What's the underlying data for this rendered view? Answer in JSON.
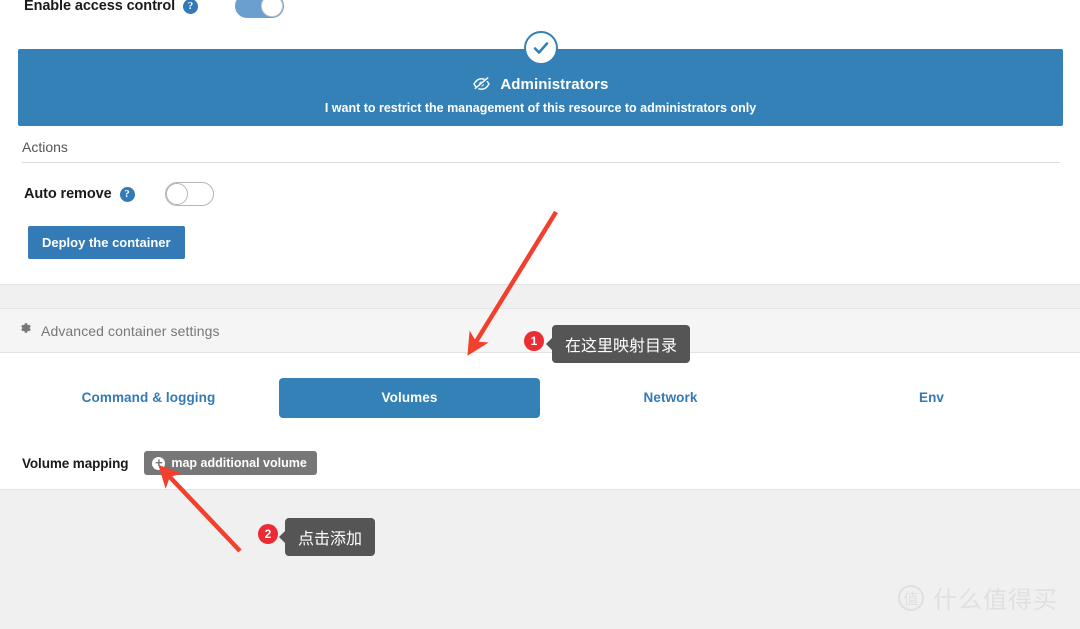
{
  "access_control": {
    "label": "Enable access control",
    "help_icon": "question-circle-icon",
    "toggle_state": "on"
  },
  "admin_card": {
    "check_icon": "check-circle-icon",
    "title_icon": "eye-slash-icon",
    "title": "Administrators",
    "subtitle": "I want to restrict the management of this resource to administrators only",
    "background_color": "#3481b8"
  },
  "actions": {
    "section_title": "Actions",
    "auto_remove_label": "Auto remove",
    "auto_remove_help_icon": "question-circle-icon",
    "auto_remove_toggle_state": "off",
    "deploy_button": "Deploy the container",
    "deploy_button_color": "#337ab7"
  },
  "advanced": {
    "header_icon": "gear-icon",
    "header_label": "Advanced container settings",
    "tabs": [
      {
        "label": "Command & logging",
        "active": false
      },
      {
        "label": "Volumes",
        "active": true
      },
      {
        "label": "Network",
        "active": false
      },
      {
        "label": "Env",
        "active": false
      }
    ],
    "volume_mapping_label": "Volume mapping",
    "map_volume_button": "map additional volume",
    "map_volume_icon": "plus-circle-icon"
  },
  "annotations": [
    {
      "number": "1",
      "text": "在这里映射目录"
    },
    {
      "number": "2",
      "text": "点击添加"
    }
  ],
  "annotation_color": "#ec2b33",
  "watermark": {
    "mark": "值",
    "text": "什么值得买"
  }
}
